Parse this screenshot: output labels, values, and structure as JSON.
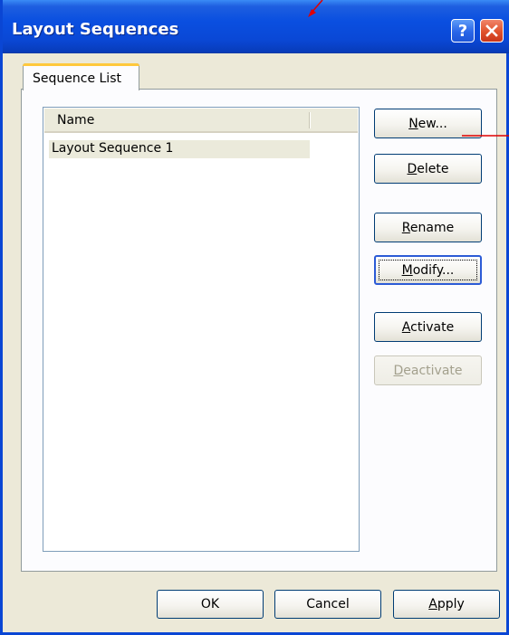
{
  "window": {
    "title": "Layout Sequences",
    "help_glyph": "?",
    "titlebar_color": "#0a4fe0"
  },
  "tabs": [
    {
      "label": "Sequence List",
      "active": true
    }
  ],
  "list": {
    "columns": [
      "Name"
    ],
    "rows": [
      "Layout Sequence 1"
    ]
  },
  "side_buttons": {
    "new": {
      "pre": "",
      "mnemonic": "N",
      "post": "ew..."
    },
    "delete": {
      "pre": "",
      "mnemonic": "D",
      "post": "elete"
    },
    "rename": {
      "pre": "",
      "mnemonic": "R",
      "post": "ename"
    },
    "modify": {
      "pre": "",
      "mnemonic": "M",
      "post": "odify..."
    },
    "activate": {
      "pre": "",
      "mnemonic": "A",
      "post": "ctivate"
    },
    "deactivate": {
      "pre": "",
      "mnemonic": "D",
      "post": "eactivate",
      "disabled": true
    }
  },
  "footer_buttons": {
    "ok": "OK",
    "cancel": "Cancel",
    "apply": {
      "pre": "",
      "mnemonic": "A",
      "post": "pply"
    }
  },
  "icons": {
    "help": "help-icon",
    "close": "close-icon"
  },
  "annotation_color": "#e00000"
}
